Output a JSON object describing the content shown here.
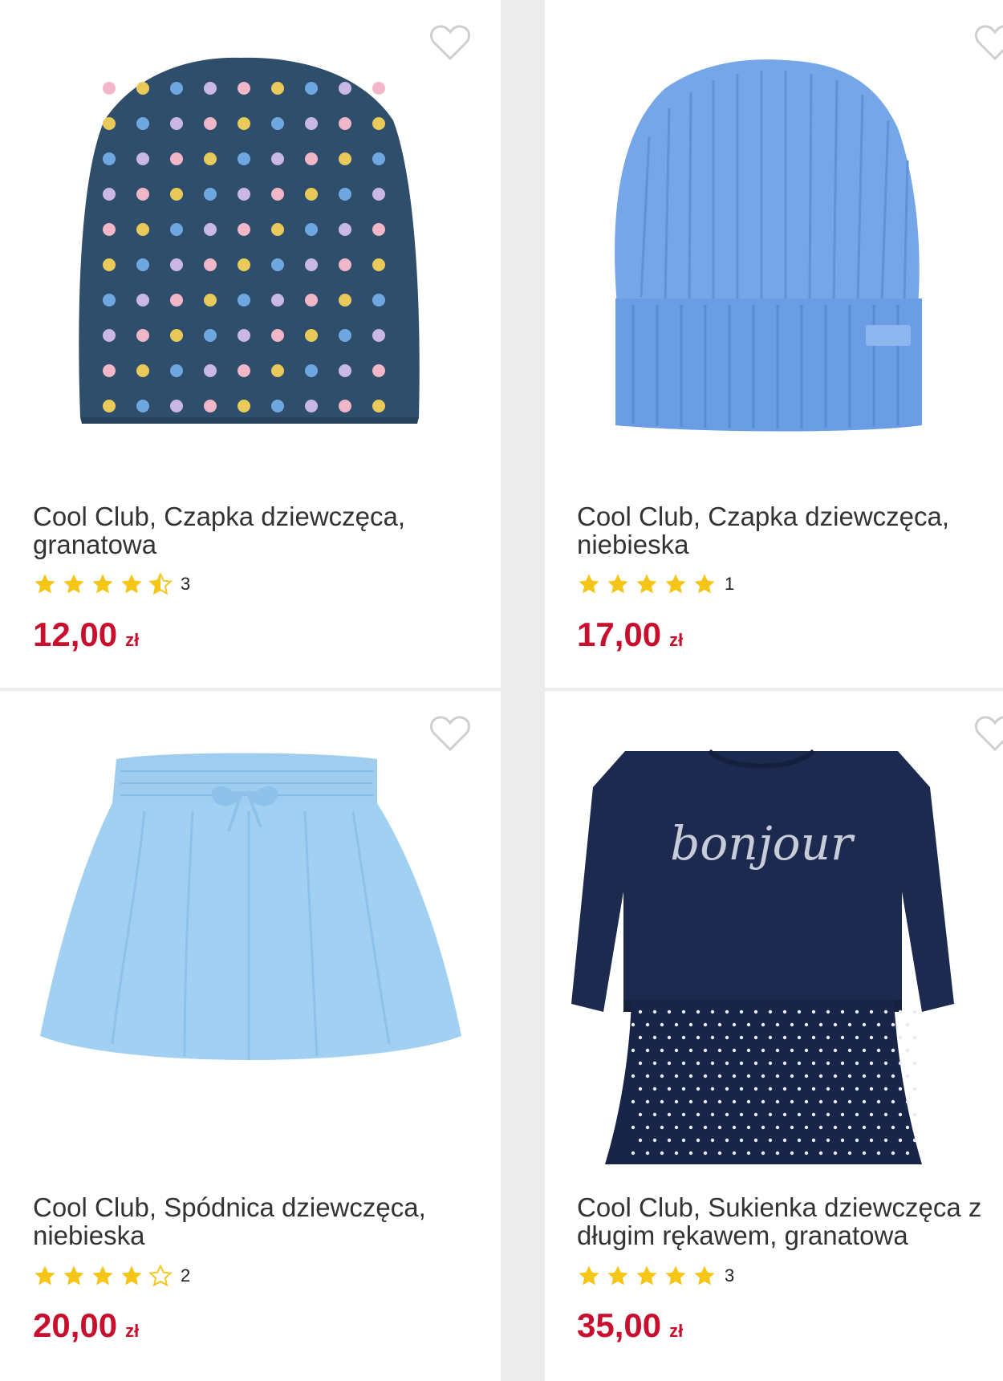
{
  "colors": {
    "price": "#c8102e",
    "star": "#f5c518",
    "heart": "#cfcfcf"
  },
  "products": [
    {
      "image": "navy-polka-dot-beanie",
      "title": "Cool Club, Czapka dziewczęca, granatowa",
      "rating": 4.5,
      "rating_count": "3",
      "price": "12,00",
      "currency": "zł"
    },
    {
      "image": "blue-knit-beanie",
      "title": "Cool Club, Czapka dziewczęca, niebieska",
      "rating": 5,
      "rating_count": "1",
      "price": "17,00",
      "currency": "zł"
    },
    {
      "image": "light-blue-skirt",
      "title": "Cool Club, Spódnica dziewczęca, niebieska",
      "rating": 4,
      "rating_count": "2",
      "price": "20,00",
      "currency": "zł"
    },
    {
      "image": "navy-bonjour-dress",
      "title": "Cool Club, Sukienka dziewczęca z długim rękawem, granatowa",
      "rating": 5,
      "rating_count": "3",
      "price": "35,00",
      "currency": "zł",
      "print_text": "bonjour"
    }
  ]
}
